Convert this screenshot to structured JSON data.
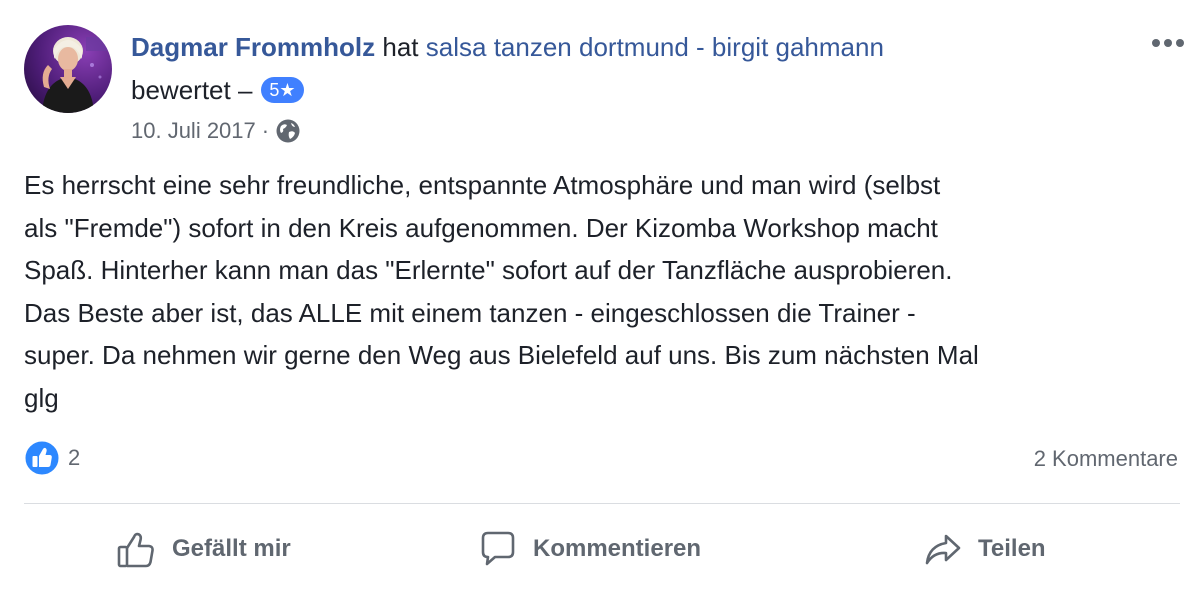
{
  "post": {
    "author": "Dagmar Frommholz",
    "action_text": "hat",
    "page_name": "salsa tanzen dortmund - birgit gahmann",
    "action_suffix": "bewertet –",
    "rating": "5★",
    "date": "10. Juli 2017",
    "meta_separator": "·",
    "audience_icon": "globe-icon",
    "body": "Es herrscht eine sehr freundliche, entspannte Atmosphäre und man wird (selbst\nals \"Fremde\") sofort in den Kreis aufgenommen. Der Kizomba Workshop macht\nSpaß. Hinterher kann man das \"Erlernte\" sofort auf der Tanzfläche ausprobieren.\nDas Beste aber ist, das ALLE mit einem tanzen - eingeschlossen die Trainer -\nsuper. Da nehmen wir gerne den Weg aus Bielefeld auf uns. Bis zum nächsten Mal\nglg"
  },
  "reactions": {
    "icon": "like-icon",
    "count": "2",
    "comments": "2 Kommentare"
  },
  "actions": {
    "like": "Gefällt mir",
    "comment": "Kommentieren",
    "share": "Teilen"
  },
  "colors": {
    "link": "#365899",
    "text": "#1d2129",
    "meta": "#616770",
    "accent": "#4080ff",
    "divider": "#dadde1"
  }
}
